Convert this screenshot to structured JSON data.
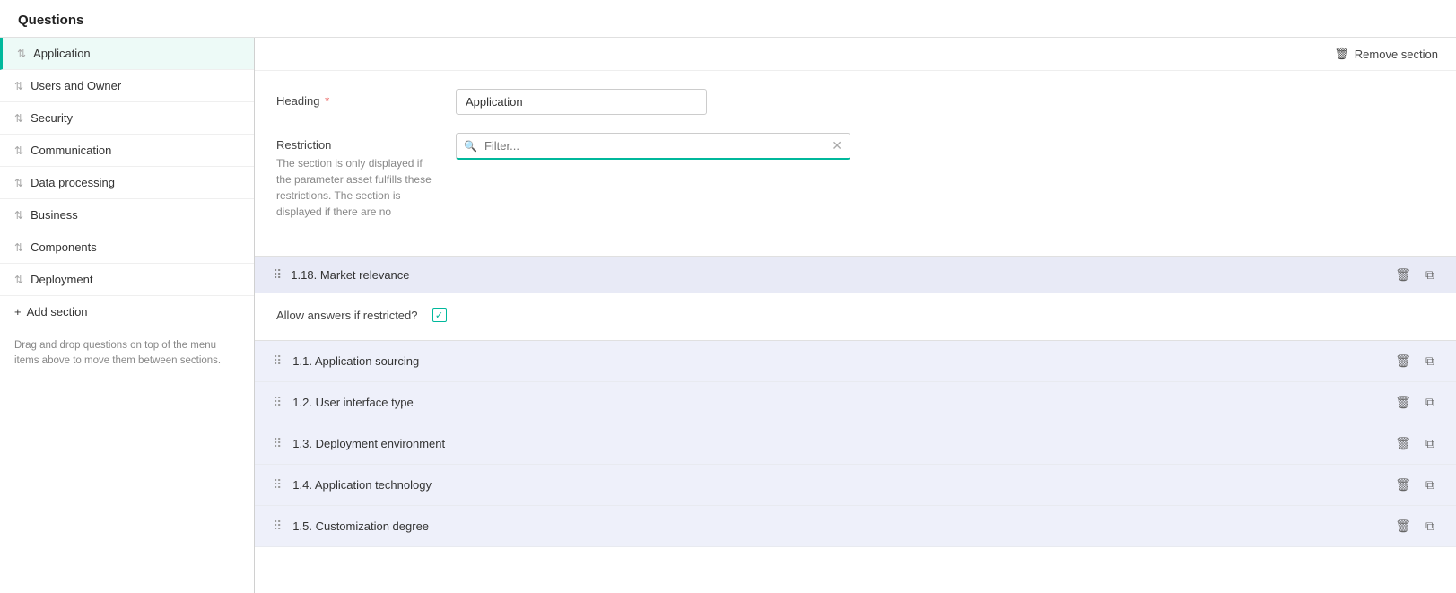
{
  "page": {
    "title": "Questions"
  },
  "sidebar": {
    "items": [
      {
        "id": "application",
        "label": "Application",
        "active": true
      },
      {
        "id": "users-and-owner",
        "label": "Users and Owner",
        "active": false
      },
      {
        "id": "security",
        "label": "Security",
        "active": false
      },
      {
        "id": "communication",
        "label": "Communication",
        "active": false
      },
      {
        "id": "data-processing",
        "label": "Data processing",
        "active": false
      },
      {
        "id": "business",
        "label": "Business",
        "active": false
      },
      {
        "id": "components",
        "label": "Components",
        "active": false
      },
      {
        "id": "deployment",
        "label": "Deployment",
        "active": false
      }
    ],
    "add_section_label": "Add section",
    "drag_hint": "Drag and drop questions on top of the menu items above to move them between sections."
  },
  "content": {
    "remove_section_label": "Remove section",
    "heading_label": "Heading",
    "heading_required": true,
    "heading_value": "Application",
    "restriction_label": "Restriction",
    "restriction_desc": "The section is only displayed if the parameter asset fulfills these restrictions. The section is displayed if there are no",
    "filter_placeholder": "Filter...",
    "allow_answers_label": "Allow answers if restricted?",
    "allow_answers_checked": true,
    "highlighted_question": {
      "number": "1.18.",
      "label": "Market relevance"
    },
    "questions": [
      {
        "number": "1.1.",
        "label": "Application sourcing"
      },
      {
        "number": "1.2.",
        "label": "User interface type"
      },
      {
        "number": "1.3.",
        "label": "Deployment environment"
      },
      {
        "number": "1.4.",
        "label": "Application technology"
      },
      {
        "number": "1.5.",
        "label": "Customization degree"
      }
    ]
  },
  "icons": {
    "drag": "⣿",
    "trash": "🗑",
    "copy": "⧉",
    "search": "🔍",
    "clear": "✕",
    "plus": "+",
    "trash_small": "&#128465;"
  }
}
